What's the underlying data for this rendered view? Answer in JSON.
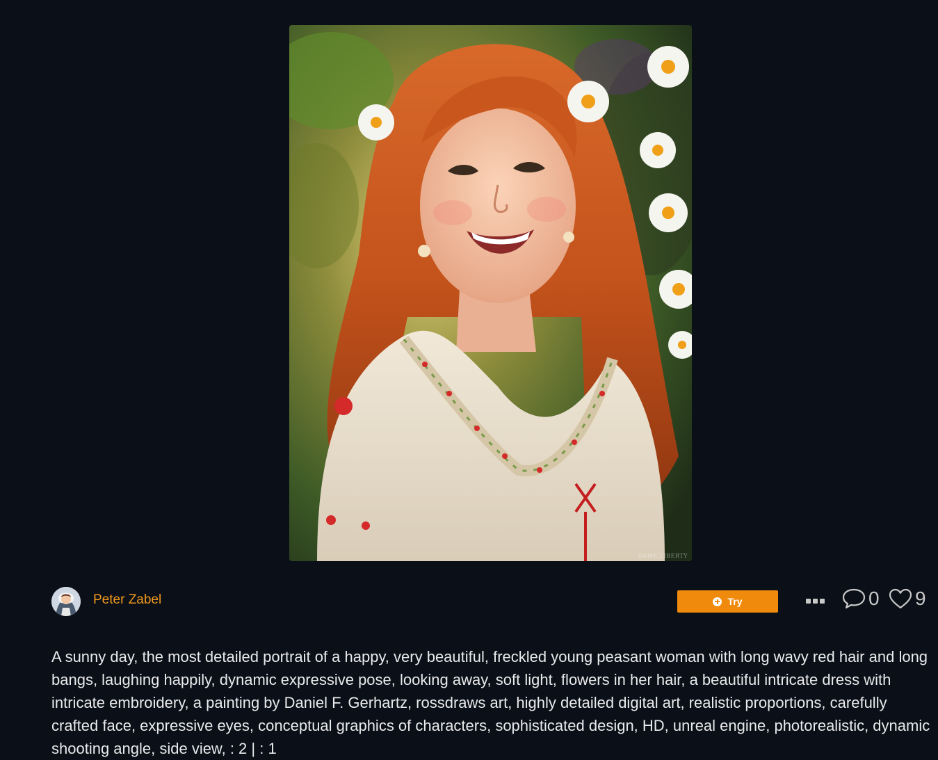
{
  "artwork": {
    "watermark": "DAME LIBERTY"
  },
  "author": {
    "name": "Peter Zabel"
  },
  "actions": {
    "try_label": "Try",
    "comment_count": "0",
    "like_count": "9"
  },
  "prompt": {
    "text": "A sunny day, the most detailed portrait of a happy, very beautiful, freckled young peasant woman with long wavy red hair and long bangs, laughing happily, dynamic expressive pose, looking away, soft light, flowers in her hair, a beautiful intricate dress with intricate embroidery, a painting by Daniel F. Gerhartz, rossdraws art, highly detailed digital art, realistic proportions, carefully crafted face, expressive eyes, conceptual graphics of characters, sophisticated design, HD, unreal engine, photorealistic, dynamic shooting angle, side view, : 2 | : 1"
  },
  "colors": {
    "background": "#0b0f17",
    "accent": "#f08a0c",
    "author_link": "#f29a1f",
    "icon_gray": "#c8c8c8"
  },
  "icons": [
    "plus-circle-icon",
    "more-dots-icon",
    "comment-icon",
    "heart-icon"
  ]
}
